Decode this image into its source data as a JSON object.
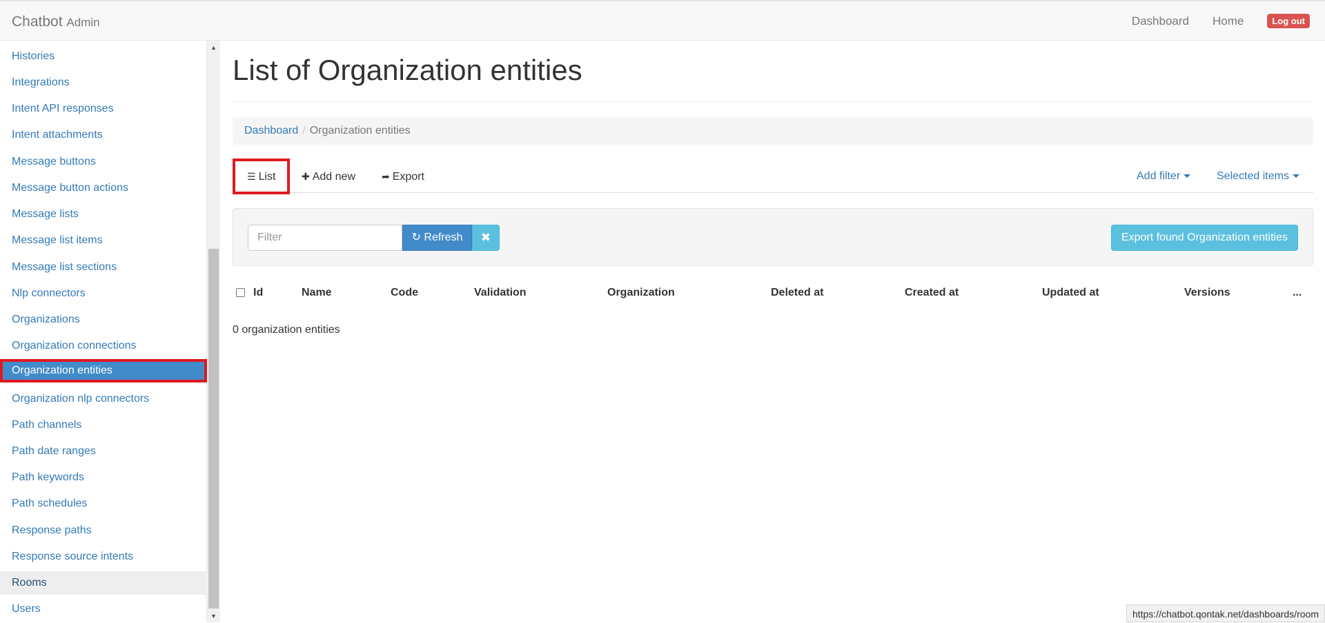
{
  "navbar": {
    "brand": "Chatbot",
    "brand_sub": "Admin",
    "links": [
      "Dashboard",
      "Home"
    ],
    "logout": "Log out"
  },
  "sidebar": {
    "items": [
      {
        "label": "Histories"
      },
      {
        "label": "Integrations"
      },
      {
        "label": "Intent API responses"
      },
      {
        "label": "Intent attachments"
      },
      {
        "label": "Message buttons"
      },
      {
        "label": "Message button actions"
      },
      {
        "label": "Message lists"
      },
      {
        "label": "Message list items"
      },
      {
        "label": "Message list sections"
      },
      {
        "label": "Nlp connectors"
      },
      {
        "label": "Organizations"
      },
      {
        "label": "Organization connections"
      },
      {
        "label": "Organization entities",
        "active": true
      },
      {
        "label": "Organization nlp connectors"
      },
      {
        "label": "Path channels"
      },
      {
        "label": "Path date ranges"
      },
      {
        "label": "Path keywords"
      },
      {
        "label": "Path schedules"
      },
      {
        "label": "Response paths"
      },
      {
        "label": "Response source intents"
      },
      {
        "label": "Rooms",
        "hover": true
      },
      {
        "label": "Users"
      }
    ]
  },
  "main": {
    "title": "List of Organization entities",
    "breadcrumb": {
      "home": "Dashboard",
      "current": "Organization entities"
    },
    "tabs": {
      "list": "List",
      "add_new": "Add new",
      "export": "Export",
      "add_filter": "Add filter",
      "selected_items": "Selected items"
    },
    "filter": {
      "placeholder": "Filter",
      "refresh": "Refresh",
      "export_found": "Export found Organization entities"
    },
    "table": {
      "columns": [
        "Id",
        "Name",
        "Code",
        "Validation",
        "Organization",
        "Deleted at",
        "Created at",
        "Updated at",
        "Versions",
        "..."
      ]
    },
    "count_text": "0 organization entities"
  },
  "status_url": "https://chatbot.qontak.net/dashboards/room",
  "colors": {
    "link": "#337ab7",
    "active_bg": "#428bca",
    "highlight_border": "#e0191f",
    "logout": "#d9534f",
    "info": "#5bc0de"
  }
}
